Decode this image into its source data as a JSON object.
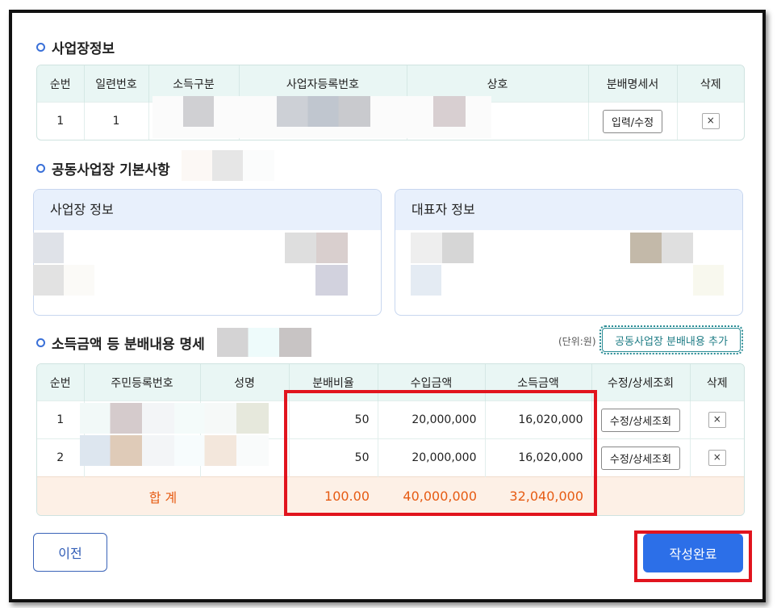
{
  "sections": {
    "business_info": "사업장정보",
    "joint_basic": "공동사업장 기본사항",
    "distribution": "소득금액 등 분배내용 명세"
  },
  "business_table": {
    "headers": [
      "순번",
      "일련번호",
      "소득구분",
      "사업자등록번호",
      "상호",
      "분배명세서",
      "삭제"
    ],
    "rows": [
      {
        "seq": "1",
        "serial": "1",
        "edit_label": "입력/수정"
      }
    ]
  },
  "panels": {
    "business": "사업장 정보",
    "representative": "대표자 정보"
  },
  "unit_label": "(단위:원)",
  "add_button": "공동사업장 분배내용 추가",
  "dist_table": {
    "headers": [
      "순번",
      "주민등록번호",
      "성명",
      "분배비율",
      "수입금액",
      "소득금액",
      "수정/상세조회",
      "삭제"
    ],
    "rows": [
      {
        "seq": "1",
        "ratio": "50",
        "income": "20,000,000",
        "earned": "16,020,000",
        "detail_label": "수정/상세조회"
      },
      {
        "seq": "2",
        "ratio": "50",
        "income": "20,000,000",
        "earned": "16,020,000",
        "detail_label": "수정/상세조회"
      }
    ],
    "total": {
      "label": "합 계",
      "ratio": "100.00",
      "income": "40,000,000",
      "earned": "32,040,000"
    }
  },
  "delete_symbol": "×",
  "buttons": {
    "prev": "이전",
    "done": "작성완료"
  },
  "colors": {
    "accent": "#2c6fe8",
    "highlight": "#e1141e",
    "total_text": "#e65b13"
  }
}
